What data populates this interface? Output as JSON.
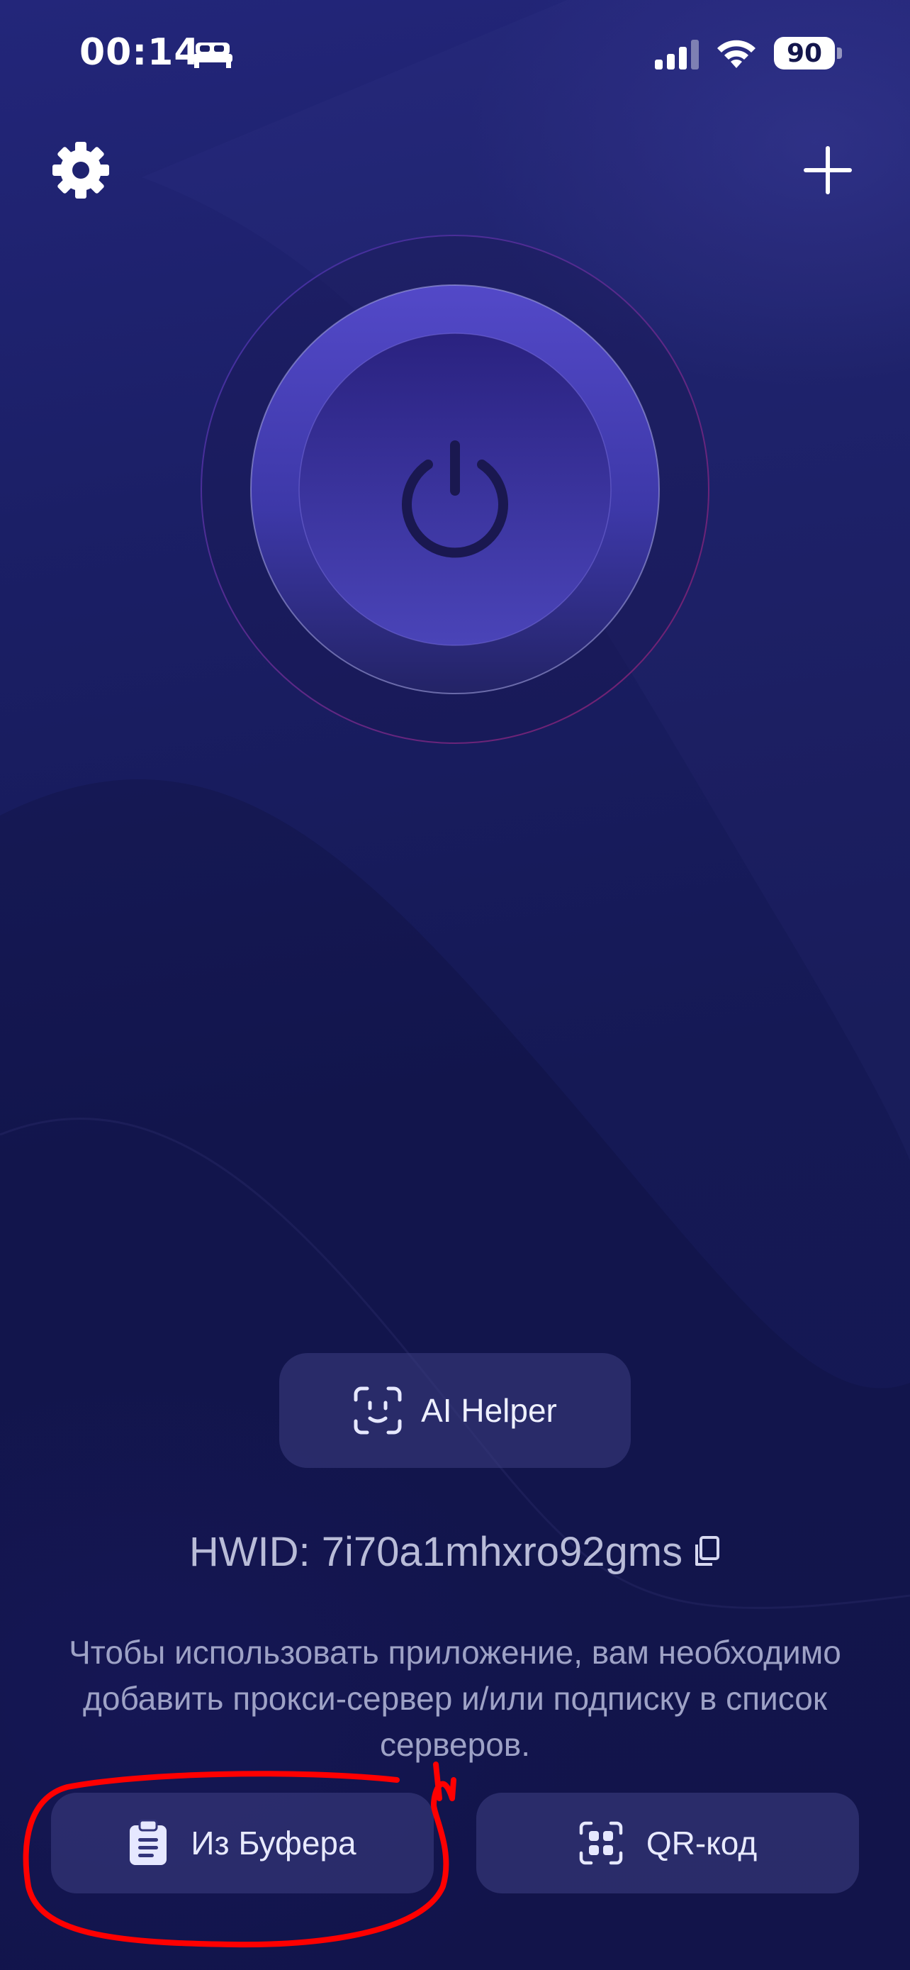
{
  "status_bar": {
    "time": "00:14",
    "battery": "90",
    "icons": [
      "sleep-bed-icon",
      "cellular-signal-icon",
      "wifi-icon",
      "battery-icon"
    ]
  },
  "header": {
    "settings_icon": "gear-icon",
    "add_icon": "plus-icon"
  },
  "power": {
    "icon": "power-icon",
    "accent": "#4a44b8"
  },
  "ai_helper": {
    "label": "AI Helper",
    "icon": "face-scan-icon"
  },
  "hwid": {
    "text": "HWID: 7i70a1mhxro92gms",
    "icon": "copy-icon"
  },
  "instructions": {
    "text": "Чтобы использовать приложение, вам необходимо добавить прокси-сервер и/или подписку в список серверов."
  },
  "buttons": {
    "clipboard": {
      "label": "Из Буфера",
      "icon": "clipboard-icon"
    },
    "qr": {
      "label": "QR-код",
      "icon": "qr-scan-icon"
    }
  },
  "colors": {
    "background": "#161a52",
    "annotation": "#ff0000"
  }
}
